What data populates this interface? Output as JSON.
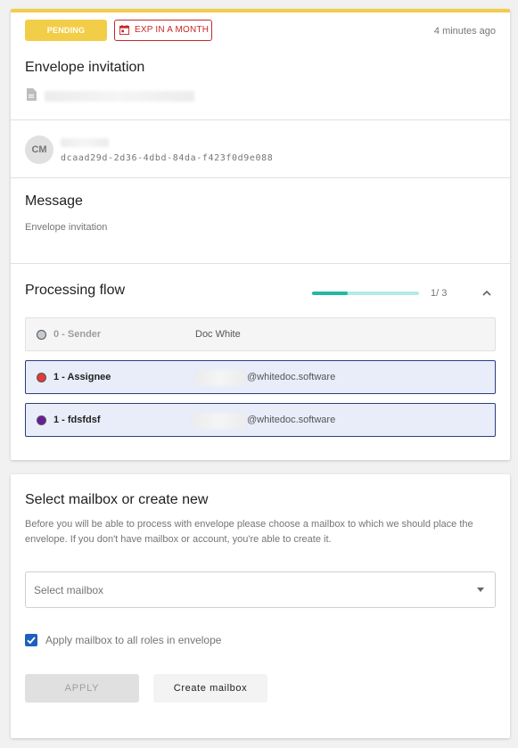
{
  "envelope": {
    "status_badge": "PENDING",
    "expiry_badge": "EXP IN A MONTH",
    "time_ago": "4 minutes ago",
    "title": "Envelope invitation",
    "doc_icon": "document-icon",
    "calendar_icon": "calendar-icon"
  },
  "sender": {
    "initials": "CM",
    "id": "dcaad29d-2d36-4dbd-84da-f423f0d9e088"
  },
  "message": {
    "heading": "Message",
    "text": "Envelope invitation"
  },
  "processing_flow": {
    "heading": "Processing flow",
    "progress_text": "1/ 3",
    "progress_fraction": 0.333,
    "collapse_icon": "chevron-up-icon",
    "steps": [
      {
        "role": "0 - Sender",
        "email": "Doc White",
        "dot_color": "#c5c9d0",
        "active": false
      },
      {
        "role": "1 - Assignee",
        "email": "@whitedoc.software",
        "dot_color": "#e53935",
        "active": true
      },
      {
        "role": "1 - fdsfdsf",
        "email": "@whitedoc.software",
        "dot_color": "#6a1b9a",
        "active": true
      }
    ]
  },
  "mailbox": {
    "heading": "Select mailbox or create new",
    "description": "Before you will be able to process with envelope please choose a mailbox to which we should place the envelope. If you don't have mailbox or account, you're able to create it.",
    "select_placeholder": "Select mailbox",
    "apply_all_label": "Apply mailbox to all roles in envelope",
    "apply_all_checked": true,
    "apply_button": "APPLY",
    "create_button": "Create mailbox"
  },
  "colors": {
    "accent_yellow": "#f2cd47",
    "expiry_red": "#c62828",
    "progress_teal": "#22b8a3",
    "active_border": "#2c3e80",
    "checkbox_blue": "#1e5fbf"
  }
}
